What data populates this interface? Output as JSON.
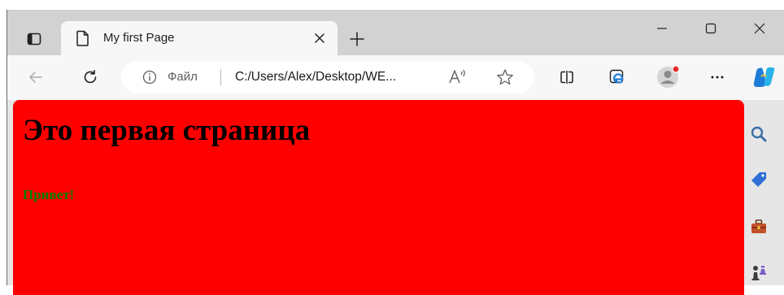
{
  "tab": {
    "title": "My first Page"
  },
  "address_bar": {
    "scheme_label": "Файл",
    "url": "C:/Users/Alex/Desktop/WE..."
  },
  "page": {
    "heading": "Это первая страница",
    "paragraph": "Привет!"
  },
  "colors": {
    "page_background": "#ff0000",
    "heading_text": "#000000",
    "paragraph_text": "#008000",
    "profile_badge": "#e8282b",
    "copilot": "#1e7dd8"
  },
  "icons": {
    "tab_actions": "tab-actions-icon",
    "page": "page-icon",
    "close_tab": "close-icon",
    "new_tab": "plus-icon",
    "minimize": "minimize-icon",
    "maximize": "maximize-icon",
    "close_window": "close-window-icon",
    "back": "back-arrow-icon",
    "refresh": "refresh-icon",
    "info": "info-icon",
    "read_aloud": "read-aloud-icon",
    "favorite": "star-icon",
    "split_screen": "split-screen-icon",
    "ie_mode": "ie-mode-icon",
    "profile": "profile-icon",
    "more": "more-icon",
    "copilot": "copilot-icon",
    "sidebar_search": "search-icon",
    "sidebar_shopping": "tag-icon",
    "sidebar_tools": "toolbox-icon",
    "sidebar_games": "chess-icon"
  }
}
